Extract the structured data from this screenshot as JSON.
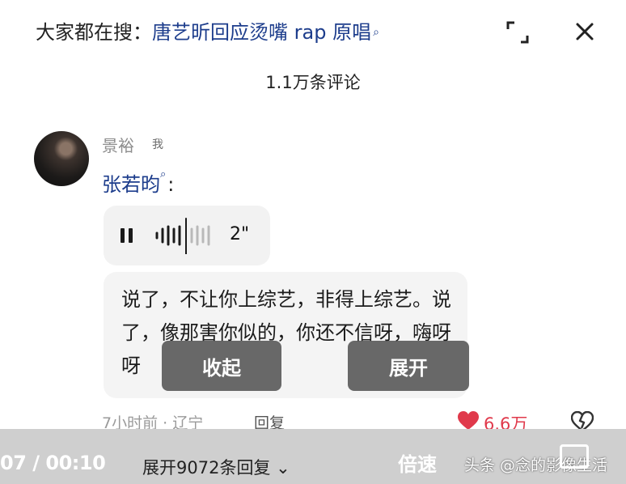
{
  "header": {
    "search_prefix": "大家都在搜：",
    "search_term": "唐艺昕回应烫嘴 rap 原唱",
    "comment_count": "1.1万条评论"
  },
  "comment": {
    "username": "景裕",
    "user_tag": "我",
    "reply_to": "张若昀",
    "voice_duration": "2\"",
    "transcript": "说了，不让你上综艺，非得上综艺。说了，像那害你似的，你还不信呀，嗨呀呀",
    "collapse_label": "收起",
    "expand_label": "展开",
    "time_location": "7小时前 · 辽宁",
    "reply_label": "回复",
    "likes": "6.6万",
    "like_color": "#e0394b"
  },
  "footer": {
    "progress_time": "07 / 00:10",
    "expand_replies": "展开9072条回复",
    "speed_label": "倍速",
    "watermark": "头条 @念的影像生活"
  }
}
